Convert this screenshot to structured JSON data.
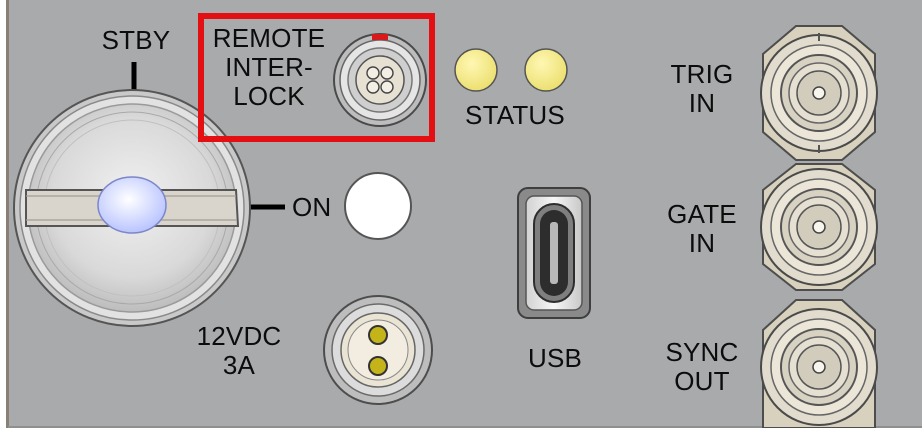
{
  "panel": {
    "colors": {
      "panel_face": "#a8a9ab",
      "panel_edge": "#7a7065",
      "highlight_box": "#e30f12",
      "status_led": "#f4ea8a",
      "pin": "#c4b419",
      "connector_body": "#e8e2d2",
      "white_button": "#ffffff",
      "key_lens": "#cfd6ff"
    }
  },
  "labels": {
    "stby": "STBY",
    "on": "ON",
    "remote_interlock": [
      "REMOTE",
      "INTER-",
      "LOCK"
    ],
    "status": "STATUS",
    "trig_in": [
      "TRIG",
      "IN"
    ],
    "gate_in": [
      "GATE",
      "IN"
    ],
    "sync_out": [
      "SYNC",
      "OUT"
    ],
    "usb": "USB",
    "power": [
      "12VDC",
      "3A"
    ]
  },
  "components": {
    "key_switch": "key-switch",
    "remote_interlock_connector": "4-pin-circular-connector",
    "status_leds": 2,
    "bnc_connectors": [
      "trig-in",
      "gate-in",
      "sync-out"
    ],
    "usb_port": "usb-c",
    "power_connector": "2-pin-circular-connector",
    "highlighted": "remote-interlock"
  }
}
